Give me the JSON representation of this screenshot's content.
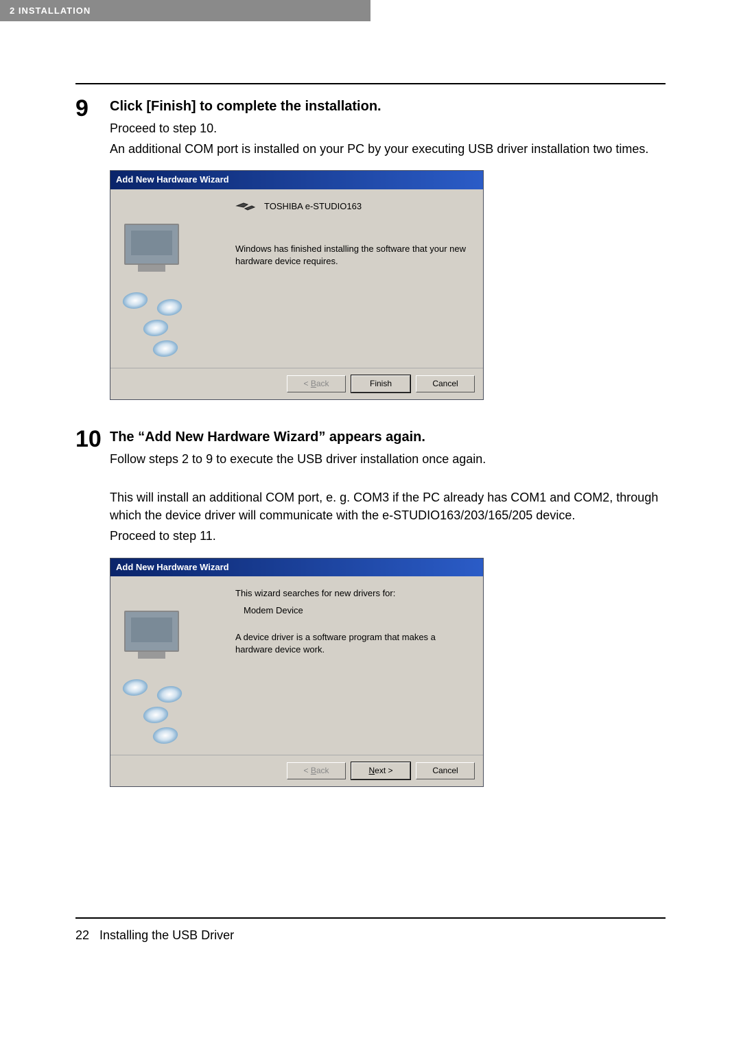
{
  "header": {
    "tab_label": "2   INSTALLATION"
  },
  "step9": {
    "number": "9",
    "heading": "Click [Finish] to complete the installation.",
    "line1": "Proceed to step 10.",
    "line2": "An additional COM port is installed on your PC by your executing USB driver installation two times."
  },
  "wizard1": {
    "title": "Add New Hardware Wizard",
    "device_name": "TOSHIBA e-STUDIO163",
    "message": "Windows has finished installing the software that your new hardware device requires.",
    "buttons": {
      "back_prefix": "< ",
      "back_accel": "B",
      "back_suffix": "ack",
      "finish": "Finish",
      "cancel": "Cancel"
    }
  },
  "step10": {
    "number": "10",
    "heading": "The “Add New Hardware Wizard” appears again.",
    "line1": "Follow steps 2 to 9 to execute the USB driver installation once again.",
    "para2": "This will install an additional COM port, e. g. COM3 if the PC already has COM1 and COM2, through which the device driver will communicate with the e-STUDIO163/203/165/205 device.",
    "line3": "Proceed to step 11."
  },
  "wizard2": {
    "title": "Add New Hardware Wizard",
    "intro": "This wizard searches for new drivers for:",
    "device_name": "Modem Device",
    "desc": "A device driver is a software program that makes a hardware device work.",
    "buttons": {
      "back_prefix": "< ",
      "back_accel": "B",
      "back_suffix": "ack",
      "next_accel": "N",
      "next_suffix": "ext >",
      "cancel": "Cancel"
    }
  },
  "footer": {
    "page_number": "22",
    "section": "Installing the USB Driver"
  }
}
